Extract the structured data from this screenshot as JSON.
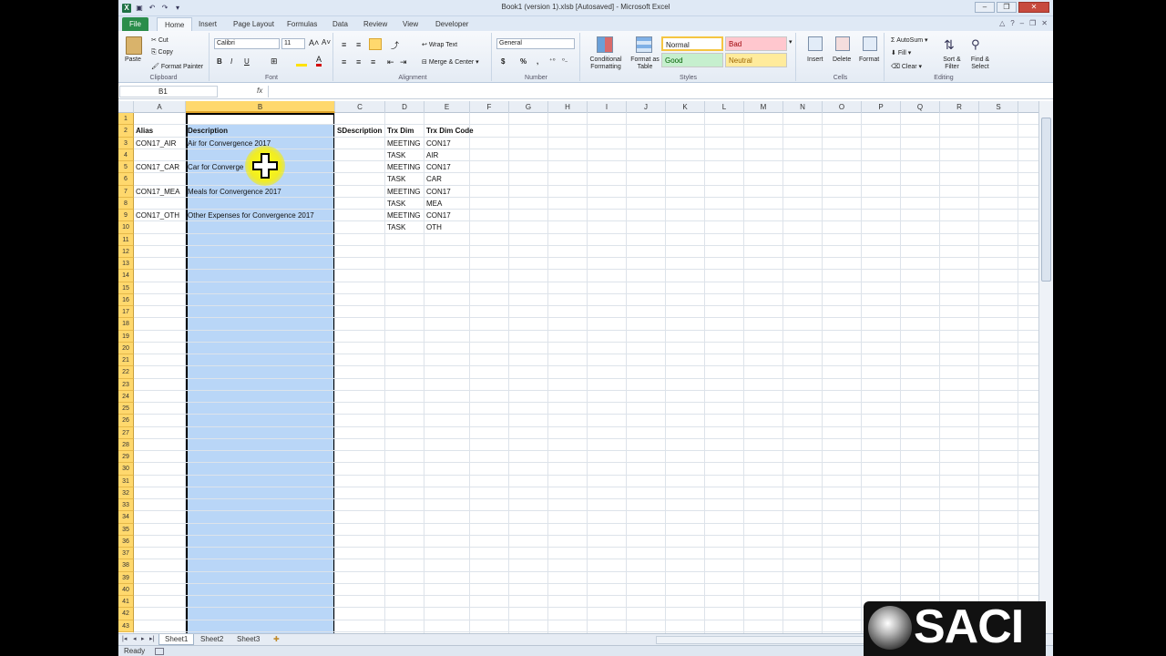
{
  "window": {
    "title": "Book1 (version 1).xlsb [Autosaved] - Microsoft Excel"
  },
  "tabs": [
    "File",
    "Home",
    "Insert",
    "Page Layout",
    "Formulas",
    "Data",
    "Review",
    "View",
    "Developer"
  ],
  "ribbon": {
    "clipboard": {
      "paste": "Paste",
      "cut": "Cut",
      "copy": "Copy",
      "format_painter": "Format Painter",
      "label": "Clipboard"
    },
    "font": {
      "name": "Calibri",
      "size": "11",
      "bold": "B",
      "italic": "I",
      "underline": "U",
      "label": "Font"
    },
    "alignment": {
      "wrap": "Wrap Text",
      "merge": "Merge & Center",
      "label": "Alignment"
    },
    "number": {
      "format": "General",
      "currency": "$",
      "percent": "%",
      "comma": ",",
      "label": "Number"
    },
    "styles": {
      "conditional": "Conditional Formatting",
      "format_table": "Format as Table",
      "normal": "Normal",
      "bad": "Bad",
      "good": "Good",
      "neutral": "Neutral",
      "label": "Styles"
    },
    "cells": {
      "insert": "Insert",
      "delete": "Delete",
      "format": "Format",
      "label": "Cells"
    },
    "editing": {
      "autosum": "AutoSum",
      "fill": "Fill",
      "clear": "Clear",
      "sort": "Sort & Filter",
      "find": "Find & Select",
      "label": "Editing"
    }
  },
  "formula_bar": {
    "name_box": "B1",
    "fx": "fx",
    "value": ""
  },
  "columns": [
    "A",
    "B",
    "C",
    "D",
    "E",
    "F",
    "G",
    "H",
    "I",
    "J",
    "K",
    "L",
    "M",
    "N",
    "O",
    "P",
    "Q",
    "R",
    "S"
  ],
  "rows": [
    "1",
    "2",
    "3",
    "4",
    "5",
    "6",
    "7",
    "8",
    "9",
    "10",
    "11",
    "12",
    "13",
    "14",
    "15",
    "16",
    "17",
    "18",
    "19",
    "20",
    "21",
    "22",
    "23",
    "24",
    "25",
    "26",
    "27",
    "28",
    "29",
    "30",
    "31",
    "32",
    "33",
    "34",
    "35",
    "36",
    "37",
    "38",
    "39",
    "40",
    "41",
    "42",
    "43"
  ],
  "cells": {
    "A2": "Alias",
    "B2": "Description",
    "C2": "SDescription",
    "D2": "Trx Dim",
    "E2": "Trx Dim Code",
    "A3": "CON17_AIR",
    "B3": "Air for Convergence 2017",
    "D3": "MEETING",
    "E3": "CON17",
    "D4": "TASK",
    "E4": "AIR",
    "A5": "CON17_CAR",
    "B5": "Car for Converge",
    "D5": "MEETING",
    "E5": "CON17",
    "D6": "TASK",
    "E6": "CAR",
    "A7": "CON17_MEA",
    "B7": "Meals for Convergence 2017",
    "D7": "MEETING",
    "E7": "CON17",
    "D8": "TASK",
    "E8": "MEA",
    "A9": "CON17_OTH",
    "B9": "Other Expenses for Convergence 2017",
    "D9": "MEETING",
    "E9": "CON17",
    "D10": "TASK",
    "E10": "OTH"
  },
  "sheets": [
    "Sheet1",
    "Sheet2",
    "Sheet3"
  ],
  "status": {
    "ready": "Ready"
  },
  "logo": {
    "text": "SACI"
  }
}
